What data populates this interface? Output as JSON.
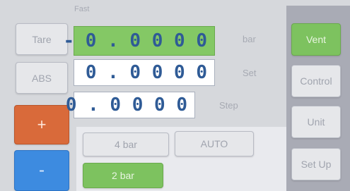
{
  "mode_label": "Fast",
  "left_buttons": {
    "tare": "Tare",
    "abs": "ABS",
    "plus": "+",
    "minus": "-"
  },
  "readouts": {
    "pressure": {
      "value": "-0.0000",
      "unit": "bar",
      "color": "#84c865"
    },
    "set": {
      "value": "0.0000",
      "label": "Set"
    },
    "step": {
      "value": "0.0000",
      "label": "Step"
    }
  },
  "ranges": {
    "items": [
      {
        "label": "4 bar",
        "active": false
      },
      {
        "label": "AUTO",
        "active": false
      },
      {
        "label": "2 bar",
        "active": true
      }
    ]
  },
  "right_menu": {
    "vent": "Vent",
    "control": "Control",
    "unit": "Unit",
    "setup": "Set Up"
  },
  "colors": {
    "active_green": "#7dc25f",
    "plus_orange": "#d96a3a",
    "minus_blue": "#3d8be0",
    "value_text": "#2f5b96"
  }
}
